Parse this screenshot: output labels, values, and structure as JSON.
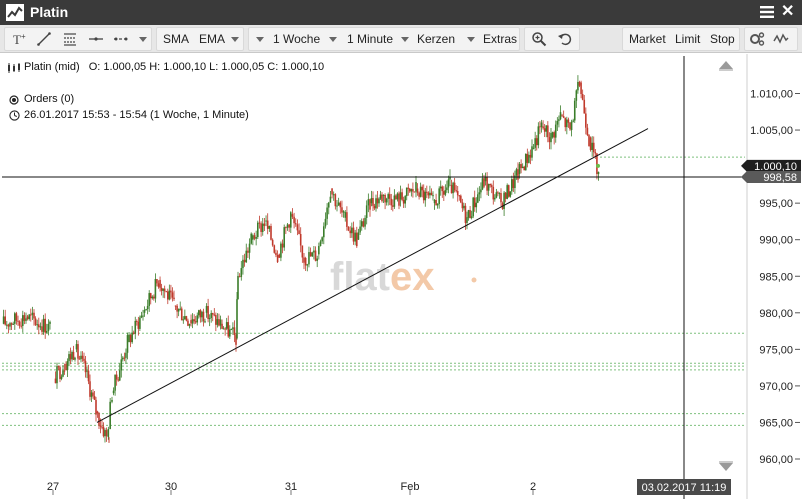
{
  "window": {
    "title": "Platin"
  },
  "toolbar": {
    "sma": "SMA",
    "ema": "EMA",
    "period": "1 Woche",
    "interval": "1 Minute",
    "chart_type": "Kerzen",
    "extras": "Extras",
    "market": "Market",
    "limit": "Limit",
    "stop": "Stop"
  },
  "header": {
    "instrument": "Platin (mid)",
    "ohlc": "O: 1.000,05  H: 1.000,10  L: 1.000,05  C: 1.000,10",
    "orders": "Orders (0)",
    "range": "26.01.2017 15:53 - 15:54   (1 Woche, 1 Minute)"
  },
  "colors": {
    "up": "#3a7d2a",
    "down": "#c0392b",
    "grid": "#7ec07e",
    "accent": "#222222"
  },
  "price_tags": {
    "last": "1.000,10",
    "cursor": "998,58"
  },
  "time_tag": "03.02.2017 11:19",
  "watermark": {
    "prefix": "flat",
    "suffix": "ex"
  },
  "chart_data": {
    "type": "candlestick",
    "ylim": [
      960,
      1012.5
    ],
    "y_ticks": [
      "960,00",
      "965,00",
      "970,00",
      "975,00",
      "980,00",
      "985,00",
      "990,00",
      "995,00",
      "1.000,00",
      "1.005,00",
      "1.010,00"
    ],
    "y_tick_values": [
      960,
      965,
      970,
      975,
      980,
      985,
      990,
      995,
      1000,
      1005,
      1010
    ],
    "x_ticks": [
      "27",
      "30",
      "31",
      "Feb",
      "2"
    ],
    "horizontal_levels": [
      1001.3,
      977.2,
      973.1,
      972.7,
      972.2,
      966.2,
      964.6
    ],
    "cursor_price": 998.58,
    "last_price": 1000.1,
    "trendline": [
      {
        "x": "27 / 30 session break",
        "y": 965.0
      },
      {
        "x": "2 / session end",
        "y": 1005.2
      }
    ],
    "price_path": [
      {
        "x": "27",
        "y": 978.5
      },
      {
        "x": "27",
        "y": 979.5
      },
      {
        "x": "27",
        "y": 978.0
      },
      {
        "x": "27",
        "y": 971.0
      },
      {
        "x": "27",
        "y": 973.0
      },
      {
        "x": "27",
        "y": 975.0
      },
      {
        "x": "27",
        "y": 972.0
      },
      {
        "x": "27",
        "y": 966.5
      },
      {
        "x": "27",
        "y": 963.0
      },
      {
        "x": "30",
        "y": 969.0
      },
      {
        "x": "30",
        "y": 976.0
      },
      {
        "x": "30",
        "y": 980.0
      },
      {
        "x": "30",
        "y": 984.5
      },
      {
        "x": "30",
        "y": 981.0
      },
      {
        "x": "30",
        "y": 979.0
      },
      {
        "x": "30",
        "y": 980.0
      },
      {
        "x": "30",
        "y": 978.5
      },
      {
        "x": "30",
        "y": 976.5
      },
      {
        "x": "31",
        "y": 985.0
      },
      {
        "x": "31",
        "y": 990.0
      },
      {
        "x": "31",
        "y": 992.5
      },
      {
        "x": "31",
        "y": 988.0
      },
      {
        "x": "31",
        "y": 993.5
      },
      {
        "x": "31",
        "y": 987.5
      },
      {
        "x": "31",
        "y": 988.0
      },
      {
        "x": "31",
        "y": 997.0
      },
      {
        "x": "31",
        "y": 993.0
      },
      {
        "x": "31",
        "y": 990.0
      },
      {
        "x": "31",
        "y": 995.0
      },
      {
        "x": "Feb",
        "y": 996.0
      },
      {
        "x": "Feb",
        "y": 995.5
      },
      {
        "x": "Feb",
        "y": 997.0
      },
      {
        "x": "Feb",
        "y": 995.0
      },
      {
        "x": "Feb",
        "y": 997.5
      },
      {
        "x": "Feb",
        "y": 993.0
      },
      {
        "x": "Feb",
        "y": 998.0
      },
      {
        "x": "Feb",
        "y": 995.0
      },
      {
        "x": "Feb",
        "y": 999.0
      },
      {
        "x": "2",
        "y": 1002.5
      },
      {
        "x": "2",
        "y": 1005.5
      },
      {
        "x": "2",
        "y": 1004.0
      },
      {
        "x": "2",
        "y": 1007.0
      },
      {
        "x": "2",
        "y": 1005.0
      },
      {
        "x": "2",
        "y": 1011.5
      },
      {
        "x": "2",
        "y": 1004.0
      },
      {
        "x": "2",
        "y": 999.0
      }
    ]
  }
}
